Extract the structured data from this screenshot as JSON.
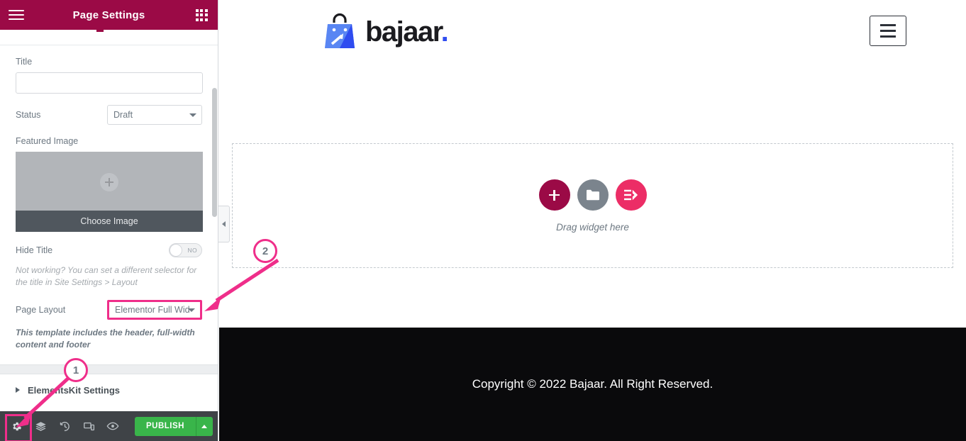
{
  "panel": {
    "header": {
      "title": "Page Settings",
      "menu_icon": "hamburger-icon",
      "widgets_icon": "grid-icon"
    },
    "fields": {
      "title_label": "Title",
      "title_value": "",
      "title_placeholder": "",
      "status_label": "Status",
      "status_value": "Draft",
      "featured_image_label": "Featured Image",
      "choose_image_label": "Choose Image",
      "hide_title_label": "Hide Title",
      "hide_title_toggle": "NO",
      "hide_title_hint": "Not working? You can set a different selector for the title in Site Settings > Layout",
      "page_layout_label": "Page Layout",
      "page_layout_value": "Elementor Full Wid",
      "page_layout_hint": "This template includes the header, full-width content and footer"
    },
    "accordion": {
      "elementskit_settings": "ElementsKit Settings"
    },
    "footer": {
      "tools": [
        {
          "name": "settings-gear-icon",
          "label": "Settings"
        },
        {
          "name": "layers-icon",
          "label": "Navigator"
        },
        {
          "name": "history-icon",
          "label": "History"
        },
        {
          "name": "responsive-icon",
          "label": "Responsive Mode"
        },
        {
          "name": "preview-eye-icon",
          "label": "Preview Changes"
        }
      ],
      "publish_label": "PUBLISH"
    },
    "collapse_icon": "chevron-left-icon"
  },
  "preview": {
    "logo_text": "bajaar",
    "logo_dot": ".",
    "nav_toggle_icon": "hamburger-icon",
    "dropzone": {
      "add_section_icon": "plus-icon",
      "folder_icon": "folder-icon",
      "elementskit_icon": "elementskit-icon",
      "label": "Drag widget here"
    },
    "footer_text": "Copyright © 2022 Bajaar. All Right Reserved."
  },
  "annotations": {
    "marker1": "1",
    "marker2": "2"
  },
  "colors": {
    "panel_header": "#9b0a46",
    "accent_pink": "#ef2e8a",
    "publish_green": "#39b54a",
    "logo_blue": "#2f4cf0",
    "footer_black": "#0a0a0c"
  }
}
